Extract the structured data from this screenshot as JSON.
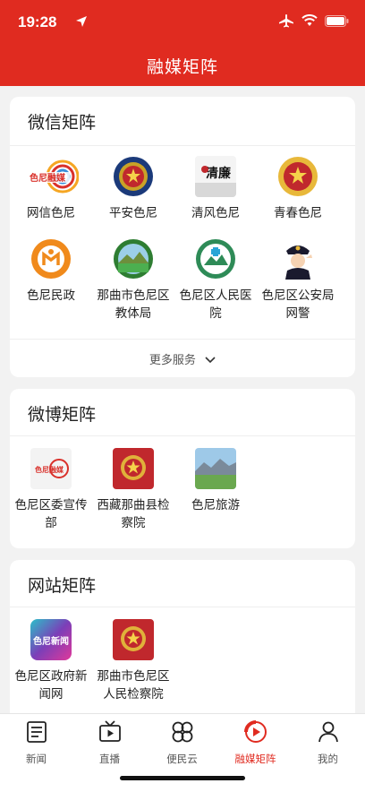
{
  "status_bar": {
    "time": "19:28"
  },
  "header": {
    "title": "融媒矩阵"
  },
  "wechat": {
    "title": "微信矩阵",
    "items": [
      {
        "label": "网信色尼",
        "logo_text": "色尼融媒"
      },
      {
        "label": "平安色尼"
      },
      {
        "label": "清风色尼",
        "logo_text": "清廉"
      },
      {
        "label": "青春色尼"
      },
      {
        "label": "色尼民政"
      },
      {
        "label": "那曲市色尼区教体局"
      },
      {
        "label": "色尼区人民医院"
      },
      {
        "label": "色尼区公安局网警"
      }
    ],
    "more_label": "更多服务"
  },
  "weibo": {
    "title": "微博矩阵",
    "items": [
      {
        "label": "色尼区委宣传部",
        "logo_text": "色尼融媒"
      },
      {
        "label": "西藏那曲县检察院"
      },
      {
        "label": "色尼旅游"
      }
    ]
  },
  "website": {
    "title": "网站矩阵",
    "items": [
      {
        "label": "色尼区政府新闻网",
        "logo_text": "色尼新闻"
      },
      {
        "label": "那曲市色尼区人民检察院"
      }
    ]
  },
  "tabbar": {
    "items": [
      {
        "label": "新闻",
        "icon": "news-icon"
      },
      {
        "label": "直播",
        "icon": "tv-icon"
      },
      {
        "label": "便民云",
        "icon": "clover-icon"
      },
      {
        "label": "融媒矩阵",
        "icon": "media-matrix-icon",
        "active": true
      },
      {
        "label": "我的",
        "icon": "user-icon"
      }
    ]
  },
  "colors": {
    "brand_red": "#e02b20"
  }
}
